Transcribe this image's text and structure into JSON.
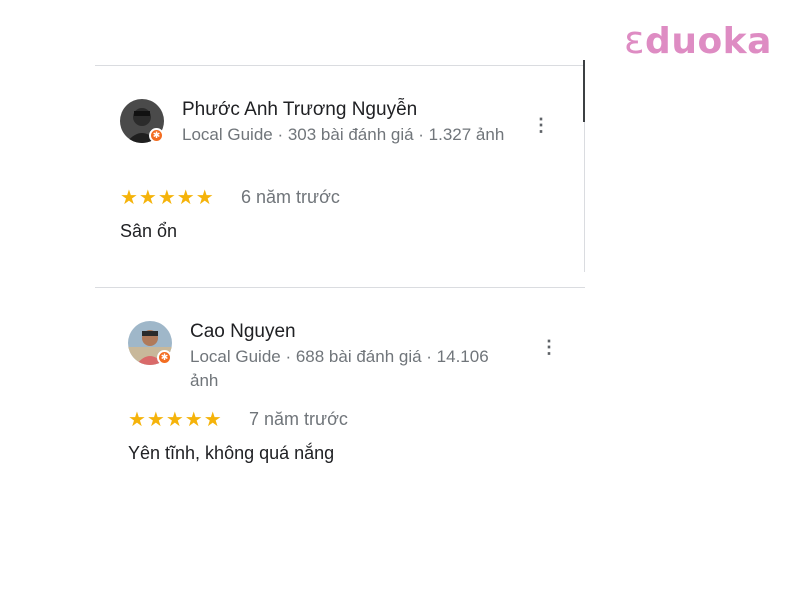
{
  "brand": {
    "logo_text": "duoka",
    "logo_initial_glyph": "ε",
    "color": "#de8cc3"
  },
  "colors": {
    "star": "#f5b30a",
    "secondary_text": "#70757a",
    "badge": "#f36d21"
  },
  "reviews": [
    {
      "reviewer_name": "Phước Anh Trương Nguyễn",
      "meta": "Local Guide · 303 bài đánh giá · 1.327 ảnh",
      "stars": "★★★★★",
      "rating": 5,
      "date": "6 năm trước",
      "text": "Sân ổn",
      "more_icon": "more-vert-icon",
      "badge_icon": "local-guide-badge-icon"
    },
    {
      "reviewer_name": "Cao Nguyen",
      "meta": "Local Guide · 688 bài đánh giá · 14.106 ảnh",
      "stars": "★★★★★",
      "rating": 5,
      "date": "7 năm trước",
      "text": "Yên tĩnh, không quá nắng",
      "more_icon": "more-vert-icon",
      "badge_icon": "local-guide-badge-icon"
    }
  ]
}
